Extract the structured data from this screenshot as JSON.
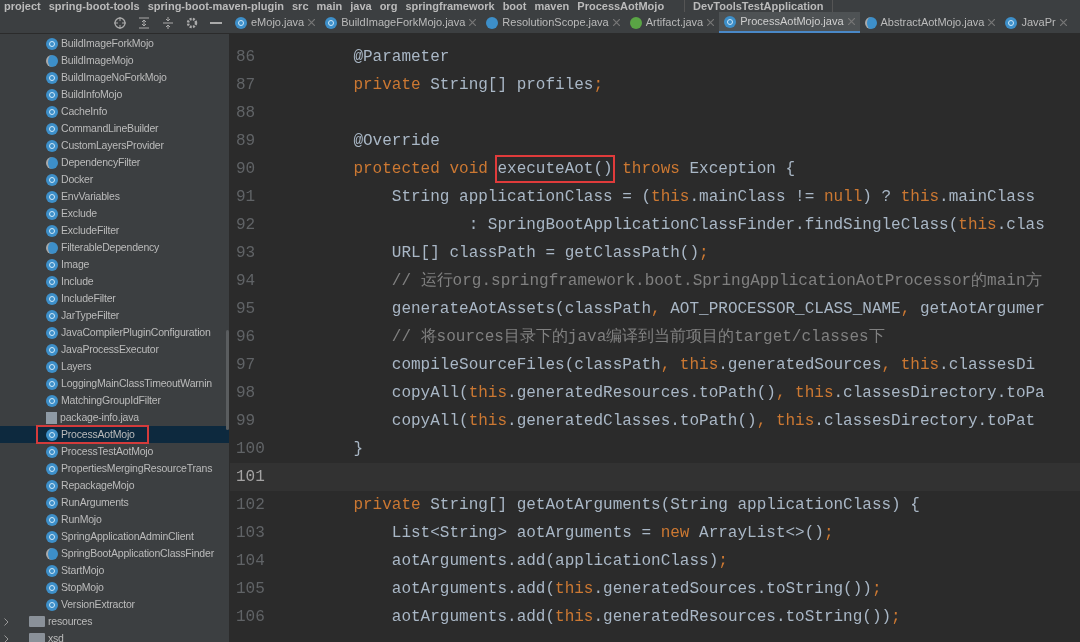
{
  "breadcrumb": [
    "project",
    "spring-boot-tools",
    "spring-boot-maven-plugin",
    "src",
    "main",
    "java",
    "org",
    "springframework",
    "boot",
    "maven",
    "ProcessAotMojo"
  ],
  "run_config": "DevToolsTestApplication",
  "tabs": [
    {
      "label": "eMojo.java",
      "kind": "class",
      "selected": false
    },
    {
      "label": "BuildImageForkMojo.java",
      "kind": "class",
      "selected": false
    },
    {
      "label": "ResolutionScope.java",
      "kind": "enum",
      "selected": false
    },
    {
      "label": "Artifact.java",
      "kind": "interface",
      "selected": false
    },
    {
      "label": "ProcessAotMojo.java",
      "kind": "class",
      "selected": true
    },
    {
      "label": "AbstractAotMojo.java",
      "kind": "abstract",
      "selected": false
    },
    {
      "label": "JavaPr",
      "kind": "class",
      "selected": false
    }
  ],
  "project_tree": [
    {
      "label": "BuildImageForkMojo",
      "kind": "class",
      "selected": false
    },
    {
      "label": "BuildImageMojo",
      "kind": "abstract",
      "selected": false
    },
    {
      "label": "BuildImageNoForkMojo",
      "kind": "class",
      "selected": false
    },
    {
      "label": "BuildInfoMojo",
      "kind": "class",
      "selected": false
    },
    {
      "label": "CacheInfo",
      "kind": "class",
      "selected": false
    },
    {
      "label": "CommandLineBuilder",
      "kind": "class",
      "selected": false
    },
    {
      "label": "CustomLayersProvider",
      "kind": "class",
      "selected": false
    },
    {
      "label": "DependencyFilter",
      "kind": "abstract",
      "selected": false
    },
    {
      "label": "Docker",
      "kind": "class",
      "selected": false
    },
    {
      "label": "EnvVariables",
      "kind": "class",
      "selected": false
    },
    {
      "label": "Exclude",
      "kind": "class",
      "selected": false
    },
    {
      "label": "ExcludeFilter",
      "kind": "class",
      "selected": false
    },
    {
      "label": "FilterableDependency",
      "kind": "abstract",
      "selected": false
    },
    {
      "label": "Image",
      "kind": "class",
      "selected": false
    },
    {
      "label": "Include",
      "kind": "class",
      "selected": false
    },
    {
      "label": "IncludeFilter",
      "kind": "class",
      "selected": false
    },
    {
      "label": "JarTypeFilter",
      "kind": "class",
      "selected": false
    },
    {
      "label": "JavaCompilerPluginConfiguration",
      "kind": "class",
      "selected": false
    },
    {
      "label": "JavaProcessExecutor",
      "kind": "class",
      "selected": false
    },
    {
      "label": "Layers",
      "kind": "class",
      "selected": false
    },
    {
      "label": "LoggingMainClassTimeoutWarnin",
      "kind": "class",
      "selected": false
    },
    {
      "label": "MatchingGroupIdFilter",
      "kind": "class",
      "selected": false
    },
    {
      "label": "package-info.java",
      "kind": "file",
      "selected": false
    },
    {
      "label": "ProcessAotMojo",
      "kind": "class",
      "selected": true
    },
    {
      "label": "ProcessTestAotMojo",
      "kind": "class",
      "selected": false
    },
    {
      "label": "PropertiesMergingResourceTrans",
      "kind": "class",
      "selected": false
    },
    {
      "label": "RepackageMojo",
      "kind": "class",
      "selected": false
    },
    {
      "label": "RunArguments",
      "kind": "class",
      "selected": false
    },
    {
      "label": "RunMojo",
      "kind": "class",
      "selected": false
    },
    {
      "label": "SpringApplicationAdminClient",
      "kind": "class",
      "selected": false
    },
    {
      "label": "SpringBootApplicationClassFinder",
      "kind": "abstract",
      "selected": false
    },
    {
      "label": "StartMojo",
      "kind": "class",
      "selected": false
    },
    {
      "label": "StopMojo",
      "kind": "class",
      "selected": false
    },
    {
      "label": "VersionExtractor",
      "kind": "class",
      "selected": false
    },
    {
      "label": "resources",
      "kind": "folder",
      "selected": false
    },
    {
      "label": "xsd",
      "kind": "folder",
      "selected": false
    }
  ],
  "code_lines": [
    {
      "number": "86",
      "current": false,
      "segments": [
        {
          "kind": "plain",
          "t": "    @Parameter"
        }
      ]
    },
    {
      "number": "87",
      "current": false,
      "segments": [
        {
          "kind": "keyword",
          "t": "    private "
        },
        {
          "kind": "plain",
          "t": "String[] profiles"
        },
        {
          "kind": "keyword",
          "t": ";"
        }
      ]
    },
    {
      "number": "88",
      "current": false
    },
    {
      "number": "89",
      "current": false,
      "segments": [
        {
          "kind": "plain",
          "t": "    @Override"
        }
      ]
    },
    {
      "number": "90",
      "current": false,
      "segments": [
        {
          "kind": "keyword",
          "t": "    protected void "
        },
        {
          "kind": "boxed",
          "t": "executeAot()"
        },
        {
          "kind": "keyword",
          "t": " throws "
        },
        {
          "kind": "plain",
          "t": "Exception {"
        }
      ]
    },
    {
      "number": "91",
      "current": false,
      "segments": [
        {
          "kind": "plain",
          "t": "        String applicationClass = ("
        },
        {
          "kind": "keyword",
          "t": "this"
        },
        {
          "kind": "plain",
          "t": ".mainClass != "
        },
        {
          "kind": "keyword",
          "t": "null"
        },
        {
          "kind": "plain",
          "t": ") ? "
        },
        {
          "kind": "keyword",
          "t": "this"
        },
        {
          "kind": "plain",
          "t": ".mainClass"
        }
      ]
    },
    {
      "number": "92",
      "current": false,
      "segments": [
        {
          "kind": "plain",
          "t": "                : SpringBootApplicationClassFinder.findSingleClass("
        },
        {
          "kind": "keyword",
          "t": "this"
        },
        {
          "kind": "plain",
          "t": ".clas"
        }
      ]
    },
    {
      "number": "93",
      "current": false,
      "segments": [
        {
          "kind": "plain",
          "t": "        URL[] classPath = getClassPath()"
        },
        {
          "kind": "keyword",
          "t": ";"
        }
      ]
    },
    {
      "number": "94",
      "current": false,
      "segments": [
        {
          "kind": "comment",
          "t": "        // 运行org.springframework.boot.SpringApplicationAotProcessor的main方"
        }
      ]
    },
    {
      "number": "95",
      "current": false,
      "segments": [
        {
          "kind": "plain",
          "t": "        generateAotAssets(classPath"
        },
        {
          "kind": "keyword",
          "t": ", "
        },
        {
          "kind": "plain",
          "t": "AOT_PROCESSOR_CLASS_NAME"
        },
        {
          "kind": "keyword",
          "t": ", "
        },
        {
          "kind": "plain",
          "t": "getAotArgumer"
        }
      ]
    },
    {
      "number": "96",
      "current": false,
      "segments": [
        {
          "kind": "comment",
          "t": "        // 将sources目录下的java编译到当前项目的target/classes下"
        }
      ]
    },
    {
      "number": "97",
      "current": false,
      "segments": [
        {
          "kind": "plain",
          "t": "        compileSourceFiles(classPath"
        },
        {
          "kind": "keyword",
          "t": ", this"
        },
        {
          "kind": "plain",
          "t": ".generatedSources"
        },
        {
          "kind": "keyword",
          "t": ", this"
        },
        {
          "kind": "plain",
          "t": ".classesDi"
        }
      ]
    },
    {
      "number": "98",
      "current": false,
      "segments": [
        {
          "kind": "plain",
          "t": "        copyAll("
        },
        {
          "kind": "keyword",
          "t": "this"
        },
        {
          "kind": "plain",
          "t": ".generatedResources.toPath()"
        },
        {
          "kind": "keyword",
          "t": ", this"
        },
        {
          "kind": "plain",
          "t": ".classesDirectory.toPa"
        }
      ]
    },
    {
      "number": "99",
      "current": false,
      "segments": [
        {
          "kind": "plain",
          "t": "        copyAll("
        },
        {
          "kind": "keyword",
          "t": "this"
        },
        {
          "kind": "plain",
          "t": ".generatedClasses.toPath()"
        },
        {
          "kind": "keyword",
          "t": ", this"
        },
        {
          "kind": "plain",
          "t": ".classesDirectory.toPat"
        }
      ]
    },
    {
      "number": "100",
      "current": false,
      "segments": [
        {
          "kind": "plain",
          "t": "    }"
        }
      ]
    },
    {
      "number": "101",
      "current": true
    },
    {
      "number": "102",
      "current": false,
      "segments": [
        {
          "kind": "keyword",
          "t": "    private "
        },
        {
          "kind": "plain",
          "t": "String[] getAotArguments(String applicationClass) {"
        }
      ]
    },
    {
      "number": "103",
      "current": false,
      "segments": [
        {
          "kind": "plain",
          "t": "        List<String> aotArguments = "
        },
        {
          "kind": "keyword",
          "t": "new "
        },
        {
          "kind": "plain",
          "t": "ArrayList<>()"
        },
        {
          "kind": "keyword",
          "t": ";"
        }
      ]
    },
    {
      "number": "104",
      "current": false,
      "segments": [
        {
          "kind": "plain",
          "t": "        aotArguments.add(applicationClass)"
        },
        {
          "kind": "keyword",
          "t": ";"
        }
      ]
    },
    {
      "number": "105",
      "current": false,
      "segments": [
        {
          "kind": "plain",
          "t": "        aotArguments.add("
        },
        {
          "kind": "keyword",
          "t": "this"
        },
        {
          "kind": "plain",
          "t": ".generatedSources.toString())"
        },
        {
          "kind": "keyword",
          "t": ";"
        }
      ]
    },
    {
      "number": "106",
      "current": false,
      "segments": [
        {
          "kind": "plain",
          "t": "        aotArguments.add("
        },
        {
          "kind": "keyword",
          "t": "this"
        },
        {
          "kind": "plain",
          "t": ".generatedResources.toString())"
        },
        {
          "kind": "keyword",
          "t": ";"
        }
      ]
    }
  ]
}
